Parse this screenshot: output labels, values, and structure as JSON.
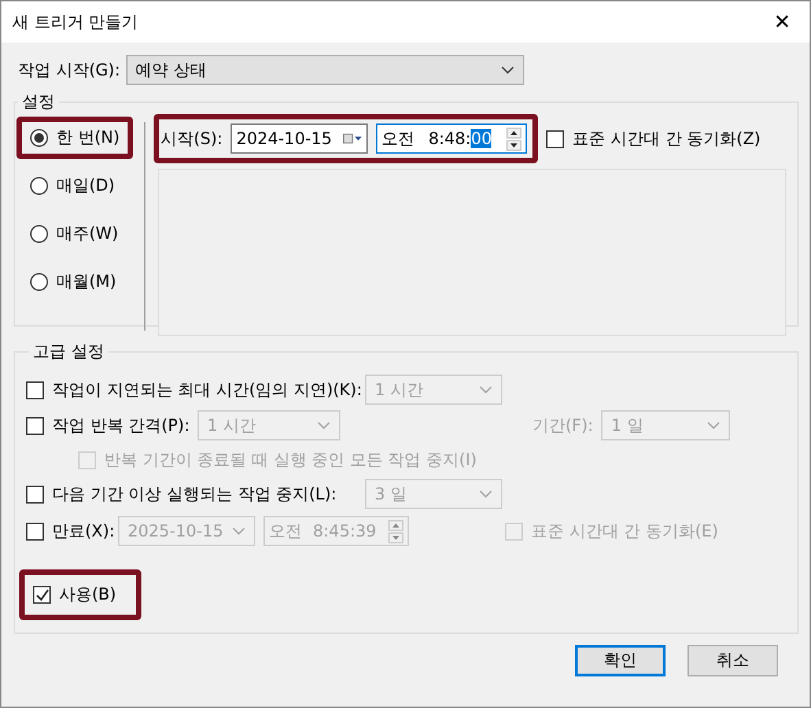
{
  "window": {
    "title": "새 트리거 만들기",
    "close": "✕"
  },
  "begin": {
    "label": "작업 시작(G):",
    "value": "예약 상태"
  },
  "settings": {
    "title": "설정",
    "schedules": [
      {
        "label": "한 번(N)",
        "selected": true,
        "highlighted": true
      },
      {
        "label": "매일(D)",
        "selected": false,
        "highlighted": false
      },
      {
        "label": "매주(W)",
        "selected": false,
        "highlighted": false
      },
      {
        "label": "매월(M)",
        "selected": false,
        "highlighted": false
      }
    ],
    "start": {
      "label": "시작(S):",
      "date": "2024-10-15",
      "period": "오전",
      "time": "8:48:",
      "time_selection": "00",
      "highlighted": true
    },
    "sync": {
      "label": "표준 시간대 간 동기화(Z)",
      "checked": false
    }
  },
  "advanced": {
    "title": "고급 설정",
    "rows": [
      {
        "kind": "dropdown",
        "label": "작업이 지연되는 최대 시간(임의 지연)(K):",
        "checked": false,
        "value": "1 시간",
        "disabled": true
      },
      {
        "kind": "repeat",
        "label": "작업 반복 간격(P):",
        "checked": false,
        "value": "1 시간",
        "disabled": true,
        "duration_label": "기간(F):",
        "duration": "1 일"
      },
      {
        "kind": "sub",
        "label": "반복 기간이 종료될 때 실행 중인 모든 작업 중지(I)",
        "checked": false,
        "disabled": true
      },
      {
        "kind": "dropdown",
        "label": "다음 기간 이상 실행되는 작업 중지(L):",
        "checked": false,
        "value": "3 일",
        "disabled": true
      },
      {
        "kind": "expire",
        "label": "만료(X):",
        "checked": false,
        "date": "2025-10-15",
        "period": "오전",
        "time": "8:45:39",
        "disabled": true,
        "sync_label": "표준 시간대 간 동기화(E)",
        "sync_checked": false
      }
    ],
    "enabled": {
      "label": "사용(B)",
      "checked": true,
      "highlighted": true
    }
  },
  "buttons": [
    {
      "label": "확인",
      "default": true
    },
    {
      "label": "취소",
      "default": false
    }
  ]
}
